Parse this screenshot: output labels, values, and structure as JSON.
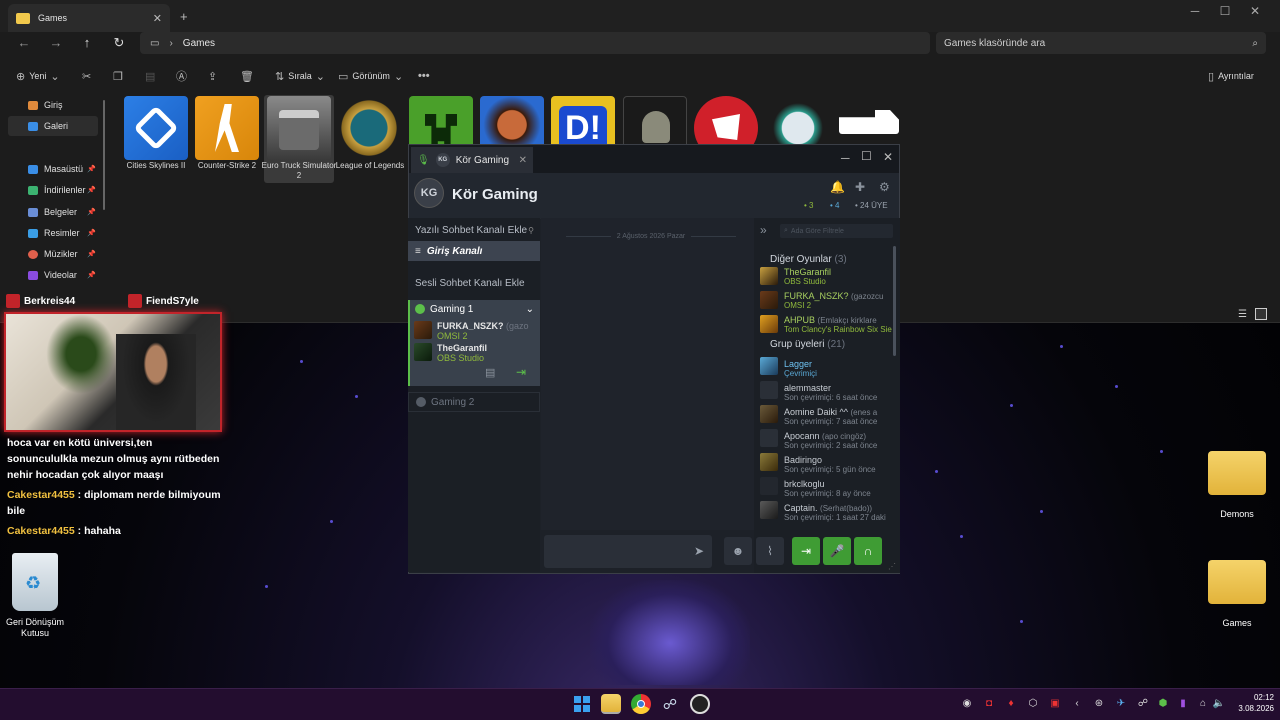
{
  "explorer": {
    "tab_title": "Games",
    "breadcrumb": "Games",
    "search_placeholder": "Games klasöründe ara",
    "toolbar": {
      "new": "Yeni",
      "sort": "Sırala",
      "view": "Görünüm",
      "details": "Ayrıntılar"
    },
    "sidebar": [
      {
        "label": "Giriş",
        "color": "#e08a3c"
      },
      {
        "label": "Galeri",
        "color": "#3a8ee6"
      },
      {
        "label": "Masaüstü",
        "color": "#3a8ee6"
      },
      {
        "label": "İndirilenler",
        "color": "#3cb371"
      },
      {
        "label": "Belgeler",
        "color": "#6a8ed6"
      },
      {
        "label": "Resimler",
        "color": "#3a9ee6"
      },
      {
        "label": "Müzikler",
        "color": "#e0604c"
      },
      {
        "label": "Videolar",
        "color": "#8a4ce0"
      }
    ],
    "items": [
      {
        "label": "Cities Skylines II"
      },
      {
        "label": "Counter-Strike 2"
      },
      {
        "label": "Euro Truck Simulator 2"
      },
      {
        "label": "League of Legends"
      }
    ]
  },
  "steam_chat": {
    "tab_title": "Kör Gaming",
    "avatar_initials": "KG",
    "group_name": "Kör Gaming",
    "stats": {
      "in_game": "3",
      "online": "4",
      "members": "24 ÜYE"
    },
    "add_text_channel": "Yazılı Sohbet Kanalı Ekle",
    "text_channel": "Giriş Kanalı",
    "add_voice_channel": "Sesli Sohbet Kanalı Ekle",
    "voice_channel_1": "Gaming 1",
    "voice_users": [
      {
        "name": "FURKA_NSZK?",
        "alias": "(gazo",
        "game": "OMSI 2"
      },
      {
        "name": "TheGaranfil",
        "alias": "",
        "game": "OBS Studio"
      }
    ],
    "voice_channel_2": "Gaming 2",
    "date_divider": "2 Ağustos 2026 Pazar",
    "member_filter_placeholder": "Ada Göre Filtrele",
    "section_other_games": "Diğer Oyunlar",
    "section_other_games_count": "(3)",
    "in_game_members": [
      {
        "name": "TheGaranfil",
        "alias": "",
        "game": "OBS Studio"
      },
      {
        "name": "FURKA_NSZK?",
        "alias": "(gazozcu",
        "game": "OMSI 2"
      },
      {
        "name": "AHPUB",
        "alias": "(Emlakçı kirklare",
        "game": "Tom Clancy's Rainbow Six Sie"
      }
    ],
    "section_group_members": "Grup üyeleri",
    "section_group_members_count": "(21)",
    "members": [
      {
        "name": "Lagger",
        "status": "Çevrimiçi",
        "online": true
      },
      {
        "name": "alemmaster",
        "status": "Son çevrimiçi: 6 saat önce"
      },
      {
        "name": "Aomine Daiki ^^",
        "alias": "(enes a",
        "status": "Son çevrimiçi: 7 saat önce"
      },
      {
        "name": "Apocann",
        "alias": "(apo cingöz)",
        "status": "Son çevrimiçi: 2 saat önce"
      },
      {
        "name": "Badiringo",
        "status": "Son çevrimiçi: 5 gün önce"
      },
      {
        "name": "brkclkoglu",
        "status": "Son çevrimiçi: 8 ay önce"
      },
      {
        "name": "Captain.",
        "alias": "(Serhat(bado))",
        "status": "Son çevrimiçi: 1 saat 27 daki"
      }
    ]
  },
  "stream": {
    "tag_left": "Berkreis44",
    "tag_right": "FiendS7yle",
    "chat": [
      {
        "user": "",
        "text": "hoca var en kötü üniversi,ten sonuncululkla mezun olmuş aynı rütbeden nehir hocadan çok alıyor maaşı"
      },
      {
        "user": "Cakestar4455",
        "text": " : diplomam nerde bilmiyoum bile"
      },
      {
        "user": "Cakestar4455",
        "text": " : hahaha"
      }
    ]
  },
  "desktop": {
    "recycle_bin": "Geri Dönüşüm Kutusu",
    "folder1": "Demons",
    "folder2": "Games"
  },
  "taskbar": {
    "time": "02:12",
    "date": "3.08.2026"
  }
}
